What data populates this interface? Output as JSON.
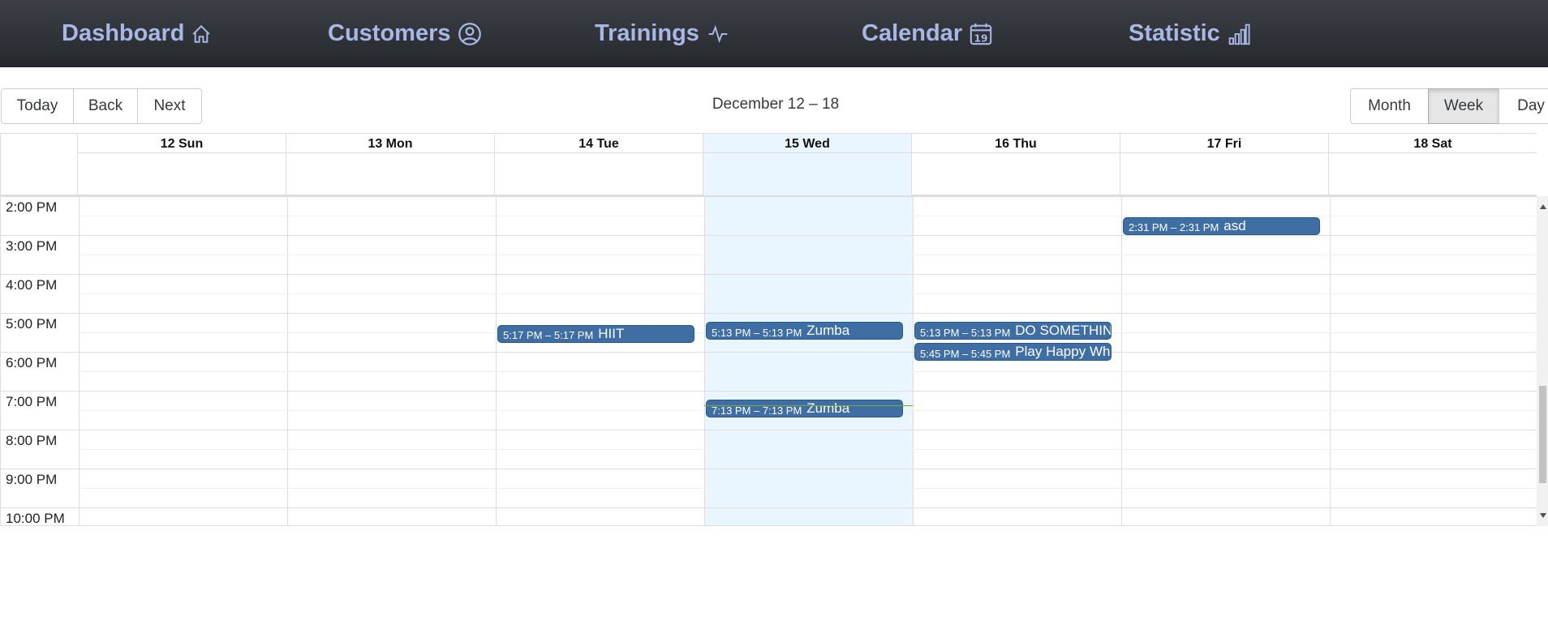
{
  "nav": {
    "dashboard": "Dashboard",
    "customers": "Customers",
    "trainings": "Trainings",
    "calendar": "Calendar",
    "calendar_icon_day": "19",
    "statistic": "Statistic",
    "icons": [
      "house-icon",
      "person-circle-icon",
      "activity-icon",
      "calendar-date-icon",
      "bar-chart-icon"
    ],
    "color": "#a9b7e6"
  },
  "toolbar": {
    "today": "Today",
    "back": "Back",
    "next": "Next",
    "range_label": "December 12 – 18",
    "views": [
      "Month",
      "Week",
      "Day"
    ],
    "active_view": "Week"
  },
  "days": [
    {
      "label": "12 Sun"
    },
    {
      "label": "13 Mon"
    },
    {
      "label": "14 Tue"
    },
    {
      "label": "15 Wed",
      "today": true
    },
    {
      "label": "16 Thu"
    },
    {
      "label": "17 Fri"
    },
    {
      "label": "18 Sat"
    }
  ],
  "times": [
    "2:00 PM",
    "3:00 PM",
    "4:00 PM",
    "5:00 PM",
    "6:00 PM",
    "7:00 PM",
    "8:00 PM",
    "9:00 PM",
    "10:00 PM"
  ],
  "events": [
    {
      "day": "17 Fri",
      "time": "2:31 PM – 2:31 PM",
      "title": "asd"
    },
    {
      "day": "14 Tue",
      "time": "5:17 PM – 5:17 PM",
      "title": "HIIT"
    },
    {
      "day": "15 Wed",
      "time": "5:13 PM – 5:13 PM",
      "title": "Zumba"
    },
    {
      "day": "16 Thu",
      "time": "5:13 PM – 5:13 PM",
      "title": "DO SOMETHING"
    },
    {
      "day": "16 Thu",
      "time": "5:45 PM – 5:45 PM",
      "title": "Play Happy Wheels"
    },
    {
      "day": "15 Wed",
      "time": "7:13 PM – 7:13 PM",
      "title": "Zumba"
    }
  ],
  "colors": {
    "event_bg": "#3e6ea4",
    "today_bg": "#eaf6ff",
    "now_indicator": "#74ad31"
  }
}
